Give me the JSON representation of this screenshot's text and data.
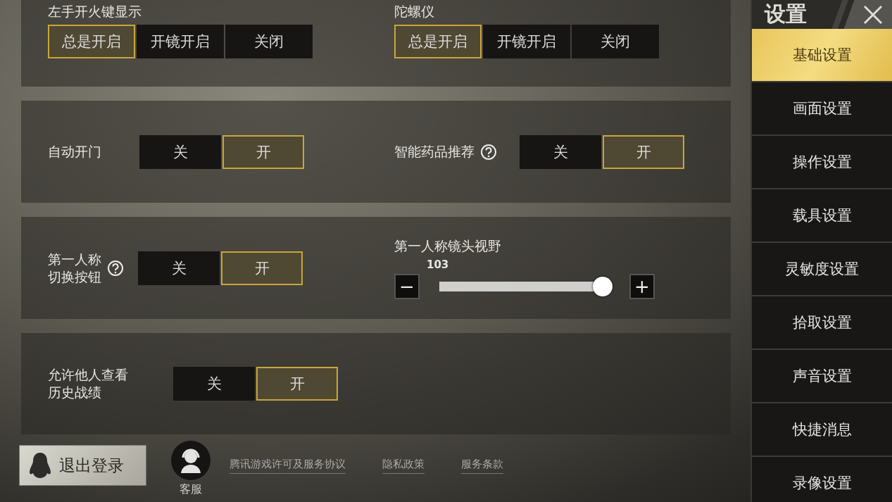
{
  "panels": [
    {
      "settings": [
        {
          "kind": "stacked",
          "label": [
            "左手开火键显示"
          ],
          "options": [
            {
              "label": "总是开启",
              "selected": true
            },
            {
              "label": "开镜开启",
              "selected": false
            },
            {
              "label": "关闭",
              "selected": false
            }
          ]
        },
        {
          "kind": "stacked",
          "label": [
            "陀螺仪"
          ],
          "options": [
            {
              "label": "总是开启",
              "selected": true
            },
            {
              "label": "开镜开启",
              "selected": false
            },
            {
              "label": "关闭",
              "selected": false
            }
          ]
        }
      ]
    },
    {
      "settings": [
        {
          "kind": "inline",
          "label": [
            "自动开门"
          ],
          "options": [
            {
              "label": "关",
              "selected": false
            },
            {
              "label": "开",
              "selected": true
            }
          ]
        },
        {
          "kind": "inline",
          "label": [
            "智能药品推荐"
          ],
          "help": true,
          "options": [
            {
              "label": "关",
              "selected": false
            },
            {
              "label": "开",
              "selected": true
            }
          ]
        }
      ]
    },
    {
      "settings": [
        {
          "kind": "inline",
          "label": [
            "第一人称",
            "切换按钮"
          ],
          "help": true,
          "options": [
            {
              "label": "关",
              "selected": false
            },
            {
              "label": "开",
              "selected": true
            }
          ]
        },
        {
          "kind": "slider",
          "label": [
            "第一人称镜头视野"
          ],
          "reading": "103",
          "level": 1,
          "minus": "−",
          "plus": "+"
        }
      ]
    },
    {
      "settings": [
        {
          "kind": "inline",
          "label": [
            "允许他人查看",
            "历史战绩"
          ],
          "options": [
            {
              "label": "关",
              "selected": false
            },
            {
              "label": "开",
              "selected": true
            }
          ]
        }
      ]
    }
  ],
  "footer": {
    "logout": "退出登录",
    "support": "客服",
    "links": [
      "腾讯游戏许可及服务协议",
      "隐私政策",
      "服务条款"
    ]
  },
  "sidebar": {
    "title": "设置",
    "items": [
      {
        "label": "基础设置",
        "selected": true
      },
      {
        "label": "画面设置",
        "selected": false
      },
      {
        "label": "操作设置",
        "selected": false
      },
      {
        "label": "载具设置",
        "selected": false
      },
      {
        "label": "灵敏度设置",
        "selected": false
      },
      {
        "label": "拾取设置",
        "selected": false
      },
      {
        "label": "声音设置",
        "selected": false
      },
      {
        "label": "快捷消息",
        "selected": false
      },
      {
        "label": "录像设置",
        "selected": false
      }
    ]
  }
}
